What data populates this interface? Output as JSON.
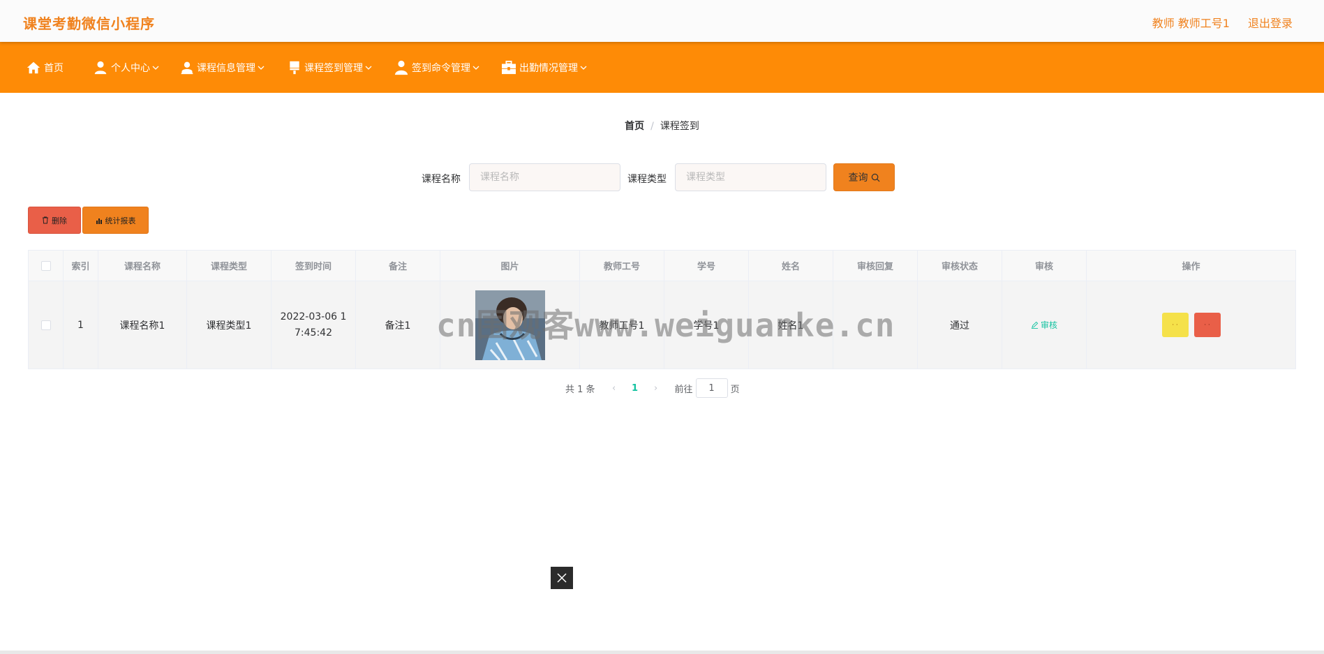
{
  "header": {
    "app_title": "课堂考勤微信小程序",
    "user_info": "教师 教师工号1",
    "logout": "退出登录"
  },
  "nav": {
    "items": [
      {
        "label": "首页",
        "icon": "home-icon"
      },
      {
        "label": "个人中心",
        "icon": "user-icon"
      },
      {
        "label": "课程信息管理",
        "icon": "user-card-icon"
      },
      {
        "label": "课程签到管理",
        "icon": "brush-icon"
      },
      {
        "label": "签到命令管理",
        "icon": "person-icon"
      },
      {
        "label": "出勤情况管理",
        "icon": "briefcase-icon"
      }
    ]
  },
  "breadcrumb": {
    "home": "首页",
    "separator": "/",
    "current": "课程签到"
  },
  "search": {
    "course_name_label": "课程名称",
    "course_name_placeholder": "课程名称",
    "course_type_label": "课程类型",
    "course_type_placeholder": "课程类型",
    "query_button": "查询"
  },
  "actions": {
    "delete_label": "删除",
    "stats_label": "统计报表"
  },
  "table": {
    "headers": [
      "索引",
      "课程名称",
      "课程类型",
      "签到时间",
      "备注",
      "图片",
      "教师工号",
      "学号",
      "姓名",
      "审核回复",
      "审核状态",
      "审核",
      "操作"
    ],
    "rows": [
      {
        "index": "1",
        "course_name": "课程名称1",
        "course_type": "课程类型1",
        "time_line1": "2022-03-06 1",
        "time_line2": "7:45:42",
        "remark": "备注1",
        "teacher_no": "教师工号1",
        "student_no": "学号1",
        "name": "姓名1",
        "reply": "",
        "status": "通过",
        "audit_label": "审核",
        "edit_label": "· ·",
        "delete_label": "· ·"
      }
    ]
  },
  "pagination": {
    "total": "共 1 条",
    "current_page": "1",
    "goto_label": "前往",
    "goto_value": "1",
    "page_suffix": "页"
  },
  "watermark": "cn围观客www.weiguanke.cn",
  "colors": {
    "accent": "#fe8b06",
    "title": "#f0821e",
    "danger": "#e95f48",
    "warning": "#f5e14a",
    "link": "#13c2a0"
  }
}
